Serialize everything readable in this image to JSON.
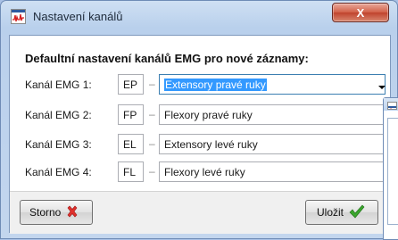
{
  "window": {
    "title": "Nastavení kanálů",
    "close_label": "X"
  },
  "heading": "Defaultní nastavení kanálů EMG pro nové záznamy:",
  "channels": [
    {
      "label": "Kanál EMG 1:",
      "code": "EP",
      "name": "Extensory pravé ruky"
    },
    {
      "label": "Kanál EMG 2:",
      "code": "FP",
      "name": "Flexory pravé ruky"
    },
    {
      "label": "Kanál EMG 3:",
      "code": "EL",
      "name": "Extensory levé ruky"
    },
    {
      "label": "Kanál EMG 4:",
      "code": "FL",
      "name": "Flexory levé ruky"
    }
  ],
  "separator_glyph": "–",
  "buttons": {
    "cancel_label": "Storno",
    "cancel_icon": "red-cross-icon",
    "save_label": "Uložit",
    "save_icon": "green-check-icon"
  },
  "colors": {
    "selection": "#3399ff",
    "title_bg": "#c3d6ee",
    "close_button": "#c0432d",
    "cancel_icon": "#e0312c",
    "save_icon": "#3aa52d"
  }
}
